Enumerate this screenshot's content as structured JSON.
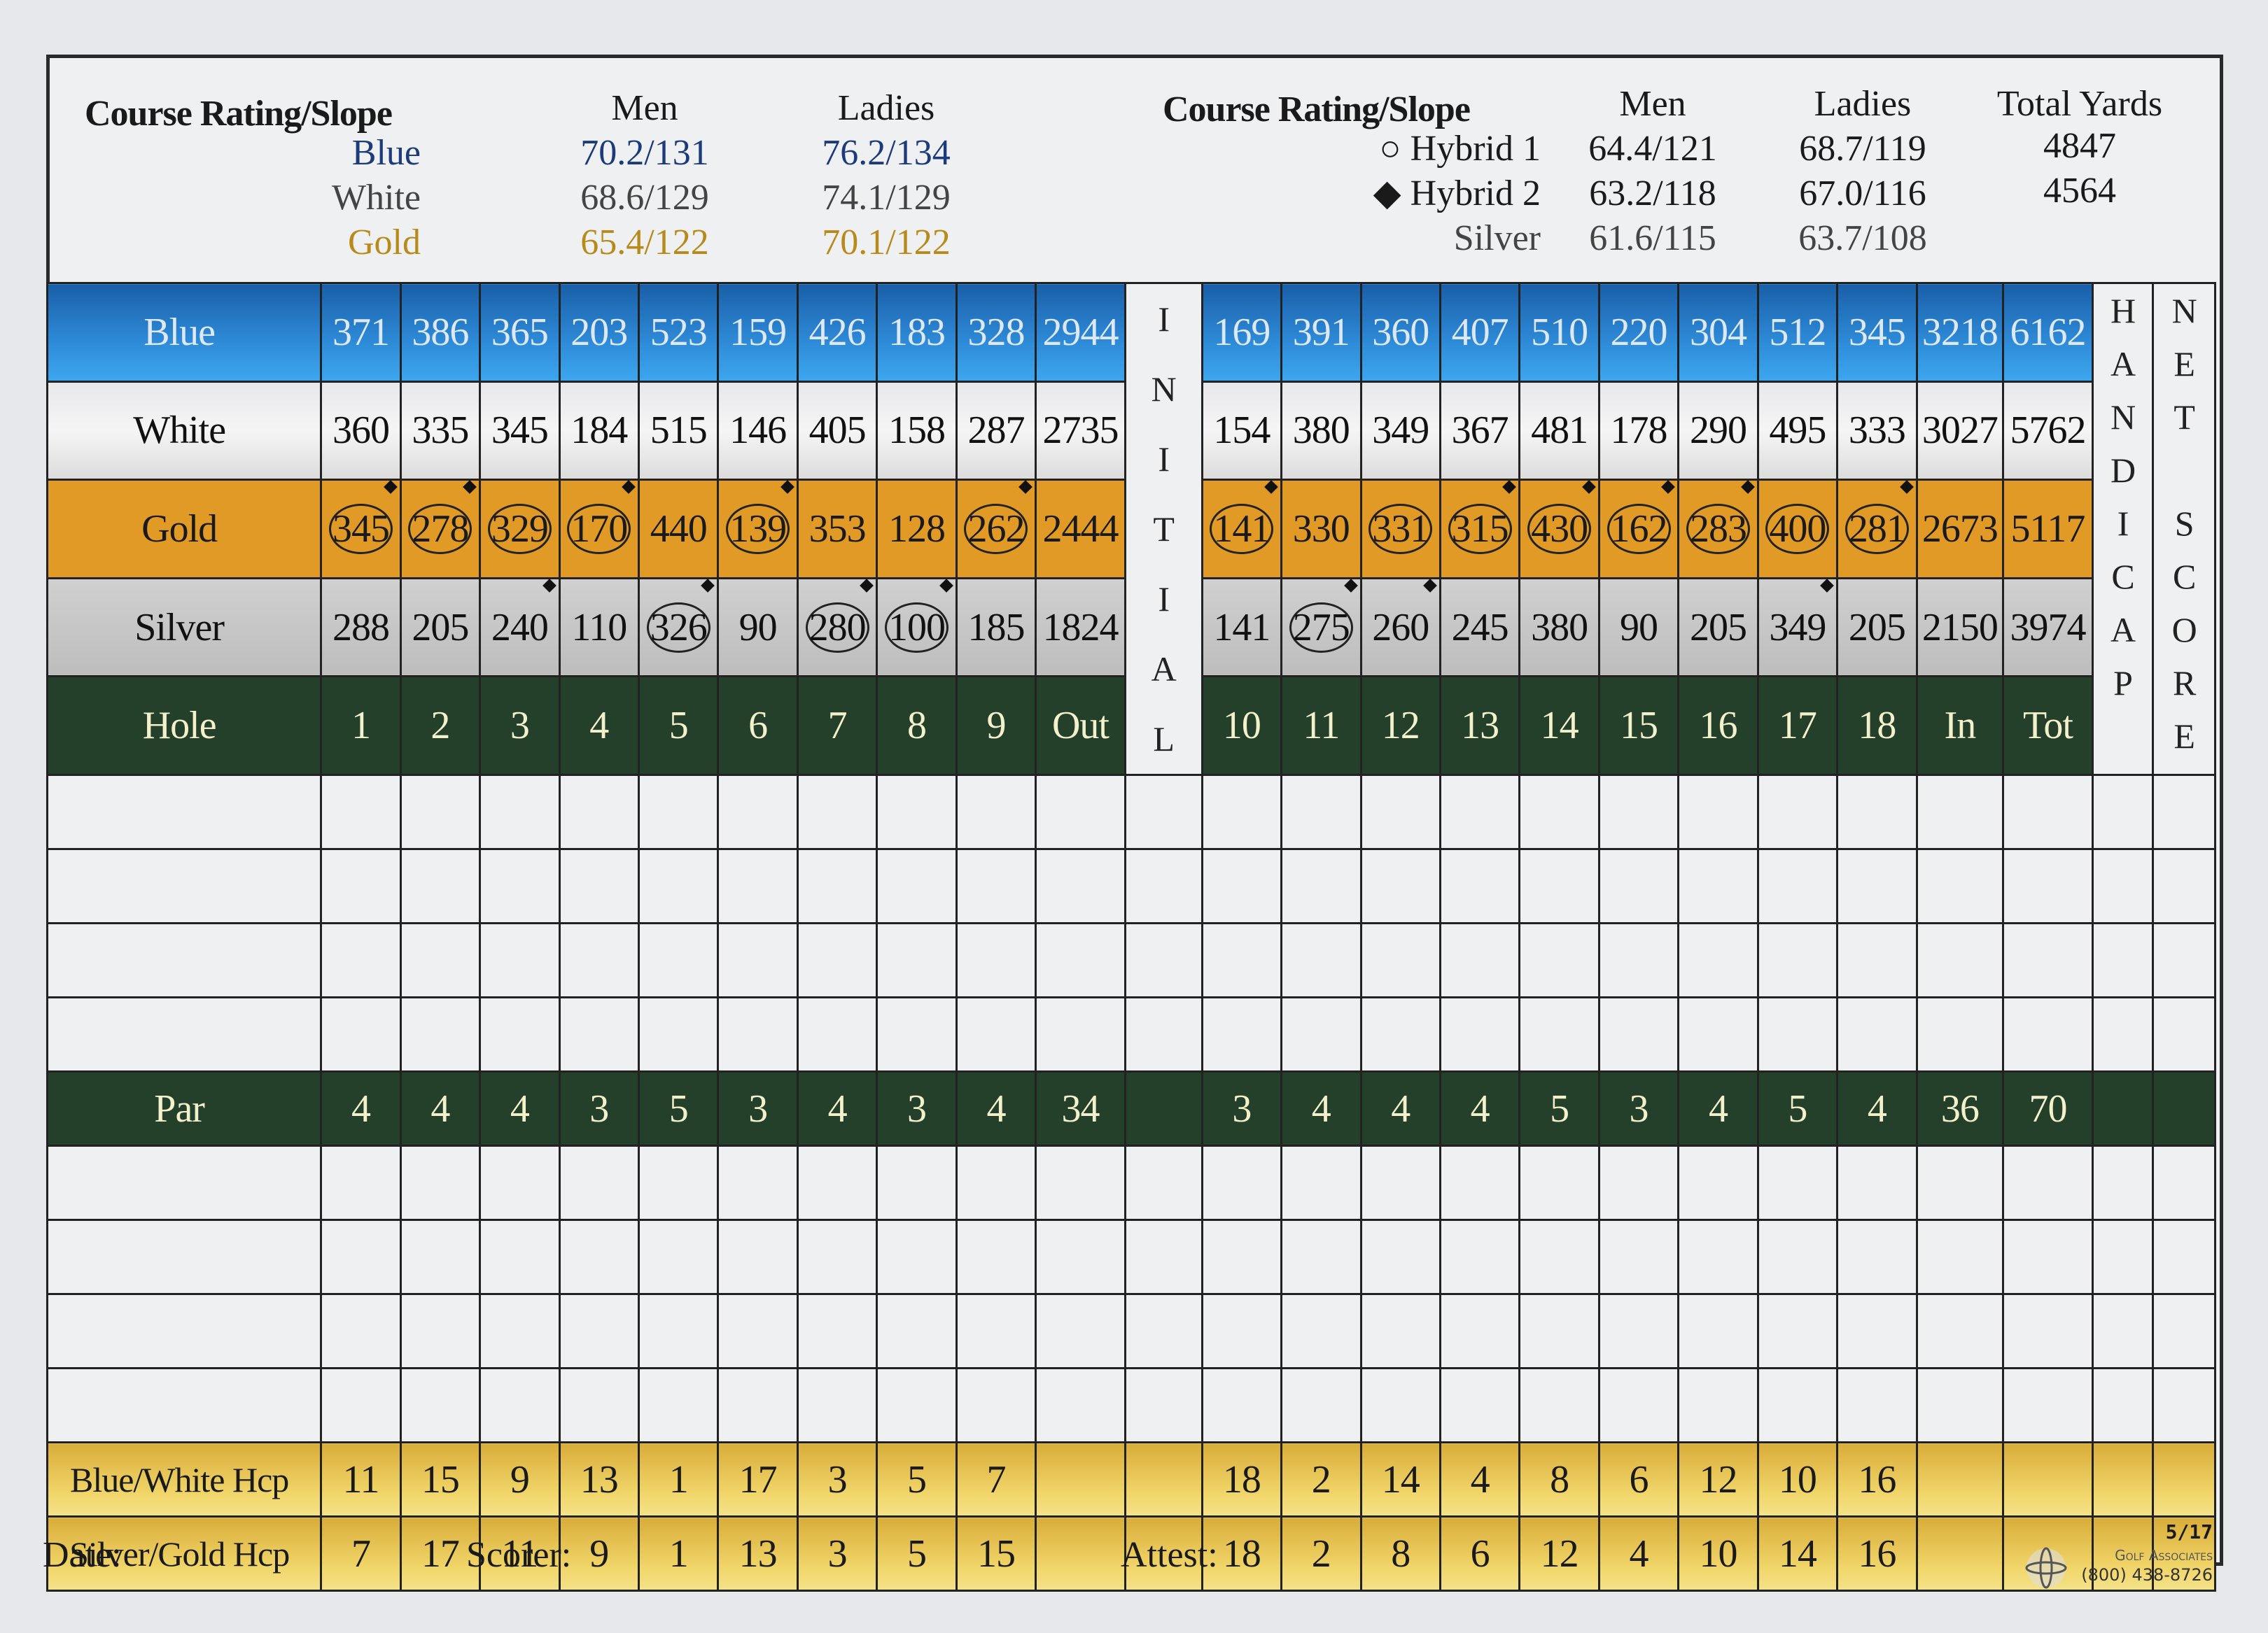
{
  "ratings_left": {
    "title": "Course Rating/Slope",
    "col_men": "Men",
    "col_ladies": "Ladies",
    "rows": [
      {
        "tee": "Blue",
        "men": "70.2/131",
        "ladies": "76.2/134",
        "color": "#1d3a7a"
      },
      {
        "tee": "White",
        "men": "68.6/129",
        "ladies": "74.1/129",
        "color": "#333333"
      },
      {
        "tee": "Gold",
        "men": "65.4/122",
        "ladies": "70.1/122",
        "color": "#b78a1a"
      }
    ]
  },
  "ratings_right": {
    "title": "Course Rating/Slope",
    "col_men": "Men",
    "col_ladies": "Ladies",
    "col_yards": "Total Yards",
    "rows": [
      {
        "marker": "○",
        "tee": "Hybrid 1",
        "men": "64.4/121",
        "ladies": "68.7/119",
        "yards": "4847"
      },
      {
        "marker": "◆",
        "tee": "Hybrid 2",
        "men": "63.2/118",
        "ladies": "67.0/116",
        "yards": "4564"
      },
      {
        "marker": "",
        "tee": "Silver",
        "men": "61.6/115",
        "ladies": "63.7/108",
        "yards": ""
      }
    ]
  },
  "colors": {
    "blue": "#2e8bd8",
    "gold": "#e29a26",
    "silver": "#c4c4c4",
    "green": "#24402b",
    "hcp": "#edd060"
  },
  "vertical_labels": {
    "initial": "INITIAL",
    "handicap": "HANDICAP",
    "net_score": "NET SCORE"
  },
  "tee_rows": [
    {
      "label": "Blue",
      "cls": "blue",
      "front": [
        "371",
        "386",
        "365",
        "203",
        "523",
        "159",
        "426",
        "183",
        "328"
      ],
      "out": "2944",
      "back": [
        "169",
        "391",
        "360",
        "407",
        "510",
        "220",
        "304",
        "512",
        "345"
      ],
      "in": "3218",
      "tot": "6162",
      "circled_front": [],
      "diamond_front": [],
      "circled_back": [],
      "diamond_back": []
    },
    {
      "label": "White",
      "cls": "white",
      "front": [
        "360",
        "335",
        "345",
        "184",
        "515",
        "146",
        "405",
        "158",
        "287"
      ],
      "out": "2735",
      "back": [
        "154",
        "380",
        "349",
        "367",
        "481",
        "178",
        "290",
        "495",
        "333"
      ],
      "in": "3027",
      "tot": "5762",
      "circled_front": [],
      "diamond_front": [],
      "circled_back": [],
      "diamond_back": []
    },
    {
      "label": "Gold",
      "cls": "gold",
      "front": [
        "345",
        "278",
        "329",
        "170",
        "440",
        "139",
        "353",
        "128",
        "262"
      ],
      "out": "2444",
      "back": [
        "141",
        "330",
        "331",
        "315",
        "430",
        "162",
        "283",
        "400",
        "281"
      ],
      "in": "2673",
      "tot": "5117",
      "circled_front": [
        0,
        1,
        2,
        3,
        5,
        8
      ],
      "diamond_front": [
        0,
        1,
        3,
        5,
        8
      ],
      "circled_back": [
        0,
        2,
        3,
        4,
        5,
        6,
        7,
        8
      ],
      "diamond_back": [
        0,
        3,
        4,
        5,
        6,
        8
      ]
    },
    {
      "label": "Silver",
      "cls": "silver",
      "front": [
        "288",
        "205",
        "240",
        "110",
        "326",
        "90",
        "280",
        "100",
        "185"
      ],
      "out": "1824",
      "back": [
        "141",
        "275",
        "260",
        "245",
        "380",
        "90",
        "205",
        "349",
        "205"
      ],
      "in": "2150",
      "tot": "3974",
      "circled_front": [
        4,
        6,
        7
      ],
      "diamond_front": [
        2,
        4,
        6,
        7
      ],
      "circled_back": [
        1
      ],
      "diamond_back": [
        1,
        2,
        7
      ]
    }
  ],
  "hole_row": {
    "label": "Hole",
    "front": [
      "1",
      "2",
      "3",
      "4",
      "5",
      "6",
      "7",
      "8",
      "9"
    ],
    "out": "Out",
    "back": [
      "10",
      "11",
      "12",
      "13",
      "14",
      "15",
      "16",
      "17",
      "18"
    ],
    "in": "In",
    "tot": "Tot"
  },
  "par_row": {
    "label": "Par",
    "front": [
      "4",
      "4",
      "4",
      "3",
      "5",
      "3",
      "4",
      "3",
      "4"
    ],
    "out": "34",
    "back": [
      "3",
      "4",
      "4",
      "4",
      "5",
      "3",
      "4",
      "5",
      "4"
    ],
    "in": "36",
    "tot": "70"
  },
  "hcp_rows": [
    {
      "label": "Blue/White Hcp",
      "front": [
        "11",
        "15",
        "9",
        "13",
        "1",
        "17",
        "3",
        "5",
        "7"
      ],
      "back": [
        "18",
        "2",
        "14",
        "4",
        "8",
        "6",
        "12",
        "10",
        "16"
      ]
    },
    {
      "label": "Silver/Gold Hcp",
      "front": [
        "7",
        "17",
        "11",
        "9",
        "1",
        "13",
        "3",
        "5",
        "15"
      ],
      "back": [
        "18",
        "2",
        "8",
        "6",
        "12",
        "4",
        "10",
        "14",
        "16"
      ]
    }
  ],
  "score_rows_top": 4,
  "score_rows_bottom": 4,
  "footer": {
    "date_label": "Date:",
    "scorer_label": "Scorer:",
    "attest_label": "Attest:",
    "version": "5/17",
    "printer_name": "Golf Associates",
    "printer_phone": "(800) 438-8726"
  }
}
